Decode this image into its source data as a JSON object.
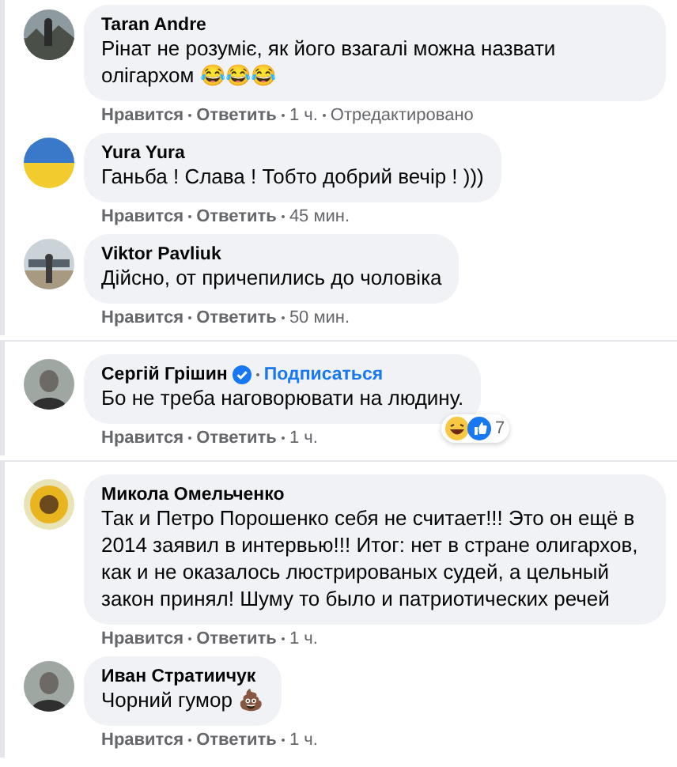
{
  "comments": [
    {
      "author": "Taran Andre",
      "avatar": {
        "kind": "picture"
      },
      "text": "Рінат не розуміє, як його взагалі можна назвати олігархом 😂😂😂",
      "meta": [
        "Нравится",
        "Ответить",
        "1 ч.",
        "Отредактировано"
      ]
    },
    {
      "author": "Yura Yura",
      "avatar": {
        "kind": "picture"
      },
      "text": "Ганьба ! Слава ! Тобто добрий вечір ! )))",
      "meta": [
        "Нравится",
        "Ответить",
        "45 мин."
      ]
    },
    {
      "author": "Viktor Pavliuk",
      "avatar": {
        "kind": "picture"
      },
      "text": "Дійсно, от причепились до чоловіка",
      "meta": [
        "Нравится",
        "Ответить",
        "50 мин."
      ]
    },
    {
      "author": "Сергій Грішин",
      "verified": true,
      "follow": "Подписаться",
      "divider_above": true,
      "avatar": {
        "kind": "picture"
      },
      "text": "Бо не треба наговорювати на людину.",
      "reactions": {
        "icons": [
          {
            "kind": "laugh"
          },
          {
            "kind": "like"
          }
        ],
        "count": "7"
      },
      "meta": [
        "Нравится",
        "Ответить",
        "1 ч."
      ]
    },
    {
      "author": "Микола Омельченко",
      "divider_above": true,
      "avatar": {
        "kind": "picture"
      },
      "text": "Так и Петро Порошенко себя не считает!!! Это он ещё в 2014 заявил в интервью!!! Итог: нет в стране олигархов, как и не оказалось люстрированых судей, а цельный закон принял! Шуму то было и патриотических речей",
      "meta": [
        "Нравится",
        "Ответить",
        "1 ч."
      ]
    },
    {
      "author": "Иван Стратиичук",
      "avatar": {
        "kind": "picture"
      },
      "text": "Чорний гумор 💩",
      "meta": [
        "Нравится",
        "Ответить",
        "1 ч."
      ]
    }
  ]
}
